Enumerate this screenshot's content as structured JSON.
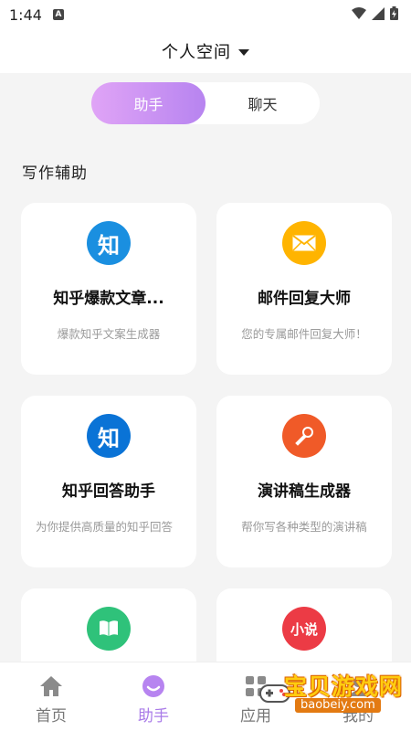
{
  "status": {
    "time": "1:44",
    "indicator": "A"
  },
  "header": {
    "title": "个人空间"
  },
  "segment": {
    "active_label": "助手",
    "inactive_label": "聊天"
  },
  "section": {
    "title": "写作辅助"
  },
  "cards": [
    {
      "title": "知乎爆款文章...",
      "desc": "爆款知乎文案生成器",
      "icon": "zhihu-icon",
      "icon_glyph": "知",
      "color": "#1a8fe0"
    },
    {
      "title": "邮件回复大师",
      "desc": "您的专属邮件回复大师！",
      "icon": "mail-icon",
      "color": "#ffb400"
    },
    {
      "title": "知乎回答助手",
      "desc": "为你提供高质量的知乎回答",
      "icon": "zhihu-icon",
      "icon_glyph": "知",
      "color": "#0a73d6"
    },
    {
      "title": "演讲稿生成器",
      "desc": "帮你写各种类型的演讲稿",
      "icon": "microphone-icon",
      "color": "#f05a28"
    },
    {
      "title": "",
      "desc": "",
      "icon": "book-icon",
      "color": "#2fc27a"
    },
    {
      "title": "",
      "desc": "",
      "icon": "novel-icon",
      "icon_glyph": "小说",
      "color": "#ec3b45"
    }
  ],
  "nav": [
    {
      "label": "首页",
      "icon": "home-icon",
      "active": false
    },
    {
      "label": "助手",
      "icon": "assistant-icon",
      "active": true
    },
    {
      "label": "应用",
      "icon": "apps-icon",
      "active": false
    },
    {
      "label": "我的",
      "icon": "profile-icon",
      "active": false
    }
  ],
  "colors": {
    "accent": "#a97be8",
    "gradient_start": "#e0a4f6",
    "gradient_end": "#b784f0"
  },
  "watermark": {
    "text": "宝贝游戏网",
    "url": "baobeiy.com"
  }
}
